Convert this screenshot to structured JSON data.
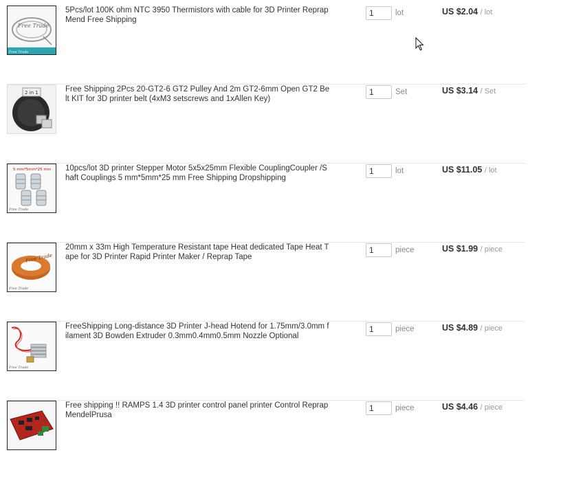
{
  "items": [
    {
      "title": "5Pcs/lot 100K ohm NTC 3950 Thermistors with cable for 3D Printer Reprap Mend Free Shipping",
      "quantity": "1",
      "unit": "lot",
      "price": "US $2.04",
      "per_unit": "/ lot",
      "thumbnail": {
        "icon": "thermistor-cable-image",
        "watermark": "Free Trade",
        "caption": "Free Trade"
      }
    },
    {
      "title": "Free Shipping 2Pcs 20-GT2-6 GT2 Pulley And 2m GT2-6mm Open GT2 Belt KIT for 3D printer belt (4xM3 setscrews and 1xAllen Key)",
      "quantity": "1",
      "unit": "Set",
      "price": "US $3.14",
      "per_unit": "/ Set",
      "thumbnail": {
        "icon": "gt2-belt-pulley-image",
        "watermark": "2 in 1",
        "caption": ""
      }
    },
    {
      "title": "10pcs/lot 3D printer Stepper Motor 5x5x25mm Flexible CouplingCoupler /Shaft Couplings 5 mm*5mm*25 mm Free Shipping Dropshipping",
      "quantity": "1",
      "unit": "lot",
      "price": "US $11.05",
      "per_unit": "/ lot",
      "thumbnail": {
        "icon": "flexible-coupler-image",
        "watermark": "5 mm*5mm*25 mm",
        "caption": "Free Trade"
      }
    },
    {
      "title": "20mm x 33m High Temperature Resistant tape Heat dedicated Tape Heat Tape for 3D Printer Rapid Printer Maker / Reprap Tape",
      "quantity": "1",
      "unit": "piece",
      "price": "US $1.99",
      "per_unit": "/ piece",
      "thumbnail": {
        "icon": "kapton-tape-image",
        "watermark": "Free Trade",
        "caption": "Free Trade"
      }
    },
    {
      "title": "FreeShipping Long-distance 3D Printer J-head Hotend for 1.75mm/3.0mm filament 3D Bowden Extruder 0.3mm0.4mm0.5mm Nozzle Optional",
      "quantity": "1",
      "unit": "piece",
      "price": "US $4.89",
      "per_unit": "/ piece",
      "thumbnail": {
        "icon": "hotend-extruder-image",
        "watermark": "",
        "caption": "Free Trade"
      }
    },
    {
      "title": "Free shipping !! RAMPS 1.4 3D printer control panel printer Control Reprap MendelPrusa",
      "quantity": "1",
      "unit": "piece",
      "price": "US $4.46",
      "per_unit": "/ piece",
      "thumbnail": {
        "icon": "ramps-board-image",
        "watermark": "",
        "caption": ""
      }
    }
  ],
  "colors": {
    "accent_orange": "#c8641e",
    "board_red": "#b3261e",
    "text": "#333333",
    "muted": "#999999"
  }
}
